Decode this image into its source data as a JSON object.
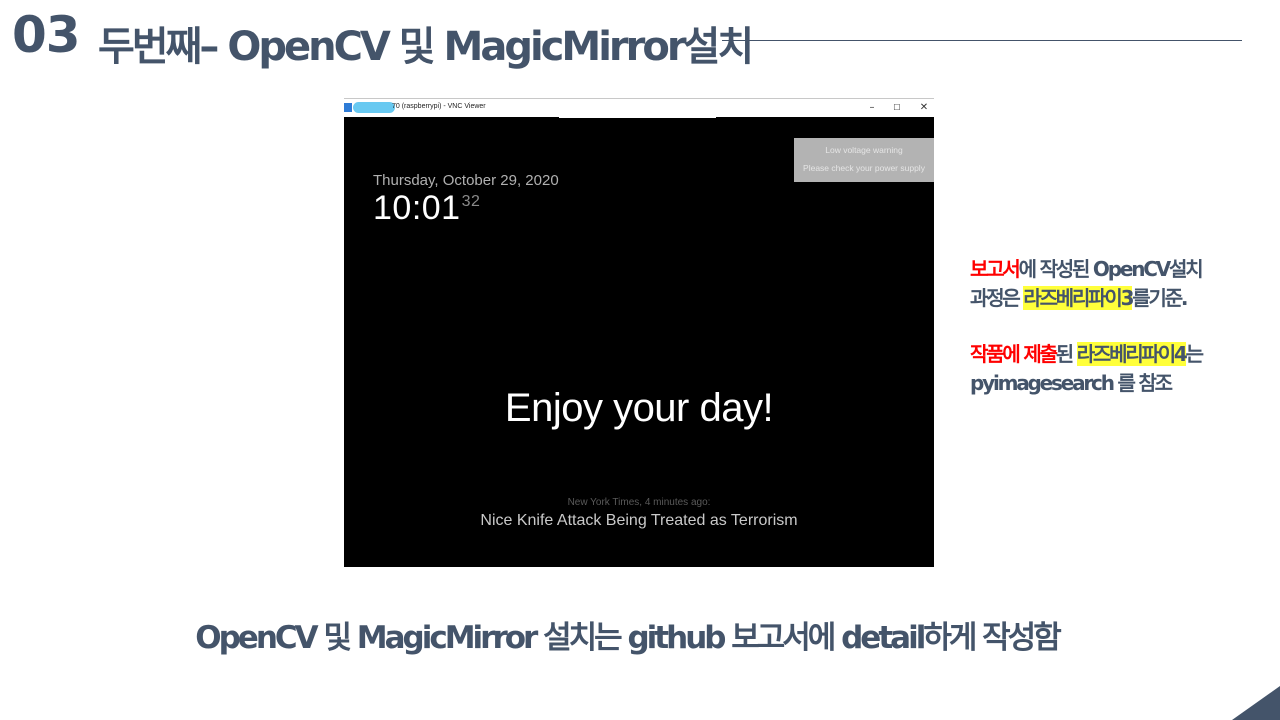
{
  "slide": {
    "number": "03",
    "title": "두번째– OpenCV 및 MagicMirror설치"
  },
  "vnc": {
    "window_title": "70 (raspberrypi) - VNC Viewer",
    "minimize": "–",
    "maximize": "☐",
    "close": "✕"
  },
  "magicmirror": {
    "date": "Thursday, October 29, 2020",
    "time": "10:01",
    "seconds": "32",
    "alert_title": "Low voltage warning",
    "alert_message": "Please check your power supply",
    "compliment": "Enjoy your day!",
    "news_source": "New York Times, 4 minutes ago:",
    "news_headline": "Nice Knife Attack Being Treated as Terrorism"
  },
  "notes": {
    "line1_red": "보고서",
    "line1_rest": "에 작성된 OpenCV설치",
    "line2_a": "과정은 ",
    "line2_hl": "라즈베리파이3",
    "line2_b": "를기준.",
    "line3_red": "작품에 제출",
    "line3_b": "된 ",
    "line3_hl": "라즈베리파이4",
    "line3_c": "는",
    "line4": "pyimagesearch 를 참조"
  },
  "footer": {
    "text": "OpenCV 및 MagicMirror 설치는 github 보고서에 detail하게 작성함"
  },
  "colors": {
    "primary": "#44546a",
    "accent_red": "#ff0000",
    "highlight": "#ffff3a"
  }
}
